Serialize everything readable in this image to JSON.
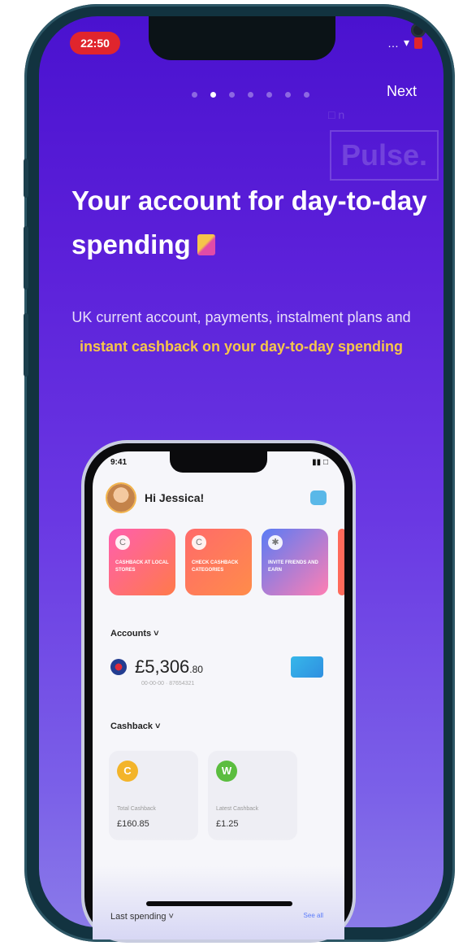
{
  "status": {
    "time": "22:50"
  },
  "onboarding": {
    "dots_total": 7,
    "active_index": 1,
    "next_label": "Next",
    "watermark_small": "□ n",
    "watermark_brand": "Pulse.",
    "headline": "Your account for day-to-day spending",
    "subtitle_plain": "UK current account, payments, instalment plans and",
    "subtitle_highlight": "instant cashback on your day-to-day spending"
  },
  "mockup": {
    "time": "9:41",
    "status_icons": "▮▮ □",
    "greeting": "Hi Jessica!",
    "promo_cards": [
      {
        "icon": "C",
        "text": "CASHBACK AT LOCAL STORES"
      },
      {
        "icon": "C",
        "text": "CHECK CASHBACK CATEGORIES"
      },
      {
        "icon": "✱",
        "text": "INVITE FRIENDS AND EARN"
      }
    ],
    "accounts_label": "Accounts ˅",
    "balance_main": "£5,306",
    "balance_pence": ".80",
    "account_sub": "00-00-00 · 87654321",
    "cashback_label": "Cashback ˅",
    "cashback_cards": [
      {
        "coin": "C",
        "coin_color": "#f3b42a",
        "label": "Total Cashback",
        "value": "£160.85"
      },
      {
        "coin": "W",
        "coin_color": "#5bbd3f",
        "label": "Latest Cashback",
        "value": "£1.25"
      }
    ],
    "last_spending_label": "Last spending ˅",
    "see_all": "See all"
  },
  "colors": {
    "accent_yellow": "#f6c64a",
    "bg_top": "#4a12cf",
    "bg_bottom": "#8a7ae9",
    "status_red": "#e0252d"
  }
}
